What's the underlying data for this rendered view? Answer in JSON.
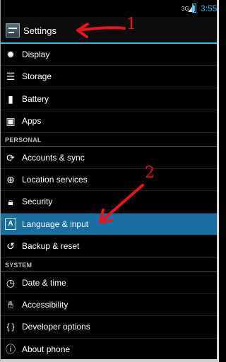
{
  "status_bar": {
    "signal": "3G",
    "time": "3:55"
  },
  "action_bar": {
    "title": "Settings"
  },
  "sections": {
    "personal": "PERSONAL",
    "system": "SYSTEM"
  },
  "items": {
    "display": "Display",
    "storage": "Storage",
    "battery": "Battery",
    "apps": "Apps",
    "accounts": "Accounts & sync",
    "location": "Location services",
    "security": "Security",
    "language": "Language & input",
    "backup": "Backup & reset",
    "datetime": "Date & time",
    "accessibility": "Accessibility",
    "developer": "Developer options",
    "about": "About phone"
  },
  "annotations": {
    "first": "1",
    "second": "2"
  },
  "colors": {
    "accent": "#33b5e5",
    "selected_row": "#1a6fa0",
    "annotation": "#e8141e"
  }
}
